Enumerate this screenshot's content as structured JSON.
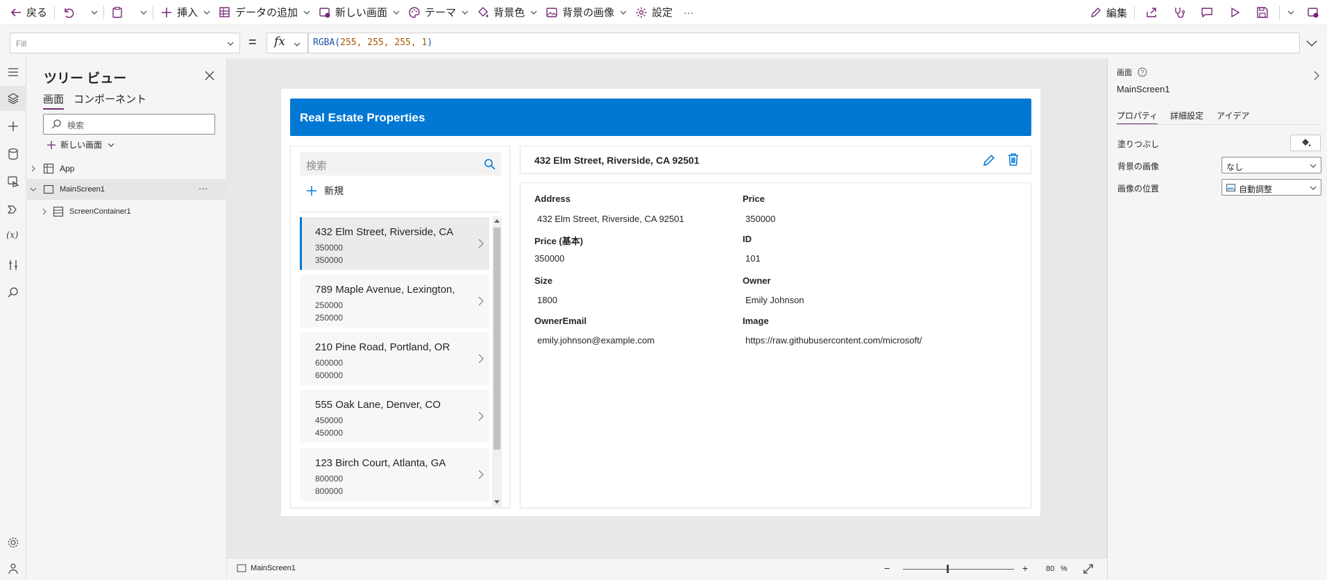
{
  "toolbar": {
    "back": "戻る",
    "insert": "挿入",
    "add_data": "データの追加",
    "new_screen": "新しい画面",
    "theme": "テーマ",
    "background_color": "背景色",
    "background_image": "背景の画像",
    "settings": "設定",
    "more": "···",
    "edit": "編集"
  },
  "formula_bar": {
    "property": "Fill",
    "equals": "=",
    "fx": "fx",
    "formula_fn": "RGBA(",
    "formula_args": "255, 255, 255, 1",
    "formula_close": ")"
  },
  "tree_view": {
    "title": "ツリー ビュー",
    "tabs": [
      "画面",
      "コンポーネント"
    ],
    "search_placeholder": "検索",
    "new_screen": "新しい画面",
    "items": [
      "App",
      "MainScreen1",
      "ScreenContainer1"
    ],
    "more": "···"
  },
  "app": {
    "header_title": "Real Estate Properties",
    "search_placeholder": "検索",
    "new_label": "新規",
    "list": [
      {
        "title": "432 Elm Street, Riverside, CA",
        "line1": "350000",
        "line2": "350000"
      },
      {
        "title": "789 Maple Avenue, Lexington,",
        "line1": "250000",
        "line2": "250000"
      },
      {
        "title": "210 Pine Road, Portland, OR",
        "line1": "600000",
        "line2": "600000"
      },
      {
        "title": "555 Oak Lane, Denver, CO",
        "line1": "450000",
        "line2": "450000"
      },
      {
        "title": "123 Birch Court, Atlanta, GA",
        "line1": "800000",
        "line2": "800000"
      }
    ],
    "detail_title": "432 Elm Street, Riverside, CA 92501",
    "fields": {
      "address_label": "Address",
      "address_value": "432 Elm Street, Riverside, CA 92501",
      "price_label": "Price",
      "price_value": "350000",
      "price_base_label": "Price (基本)",
      "price_base_value": "350000",
      "id_label": "ID",
      "id_value": "101",
      "size_label": "Size",
      "size_value": "1800",
      "owner_label": "Owner",
      "owner_value": "Emily Johnson",
      "owner_email_label": "OwnerEmail",
      "owner_email_value": "emily.johnson@example.com",
      "image_label": "Image",
      "image_value": "https://raw.githubusercontent.com/microsoft/PowerApps"
    },
    "selected_index": 0,
    "list_scroll_fraction": 0.0
  },
  "status_bar": {
    "screen_name": "MainScreen1",
    "zoom_minus": "−",
    "zoom_plus": "+",
    "zoom_value": "80",
    "zoom_unit": "%",
    "zoom_level": 0.8
  },
  "properties_panel": {
    "type_label": "画面",
    "screen_name": "MainScreen1",
    "tabs": [
      "プロパティ",
      "詳細設定",
      "アイデア"
    ],
    "fill_label": "塗りつぶし",
    "bg_image_label": "背景の画像",
    "bg_image_value": "なし",
    "image_position_label": "画像の位置",
    "image_position_value": "自動調整"
  },
  "colors": {
    "accent": "#0078d4",
    "brand_purple": "#742774",
    "formula_number": "#a05a00"
  }
}
